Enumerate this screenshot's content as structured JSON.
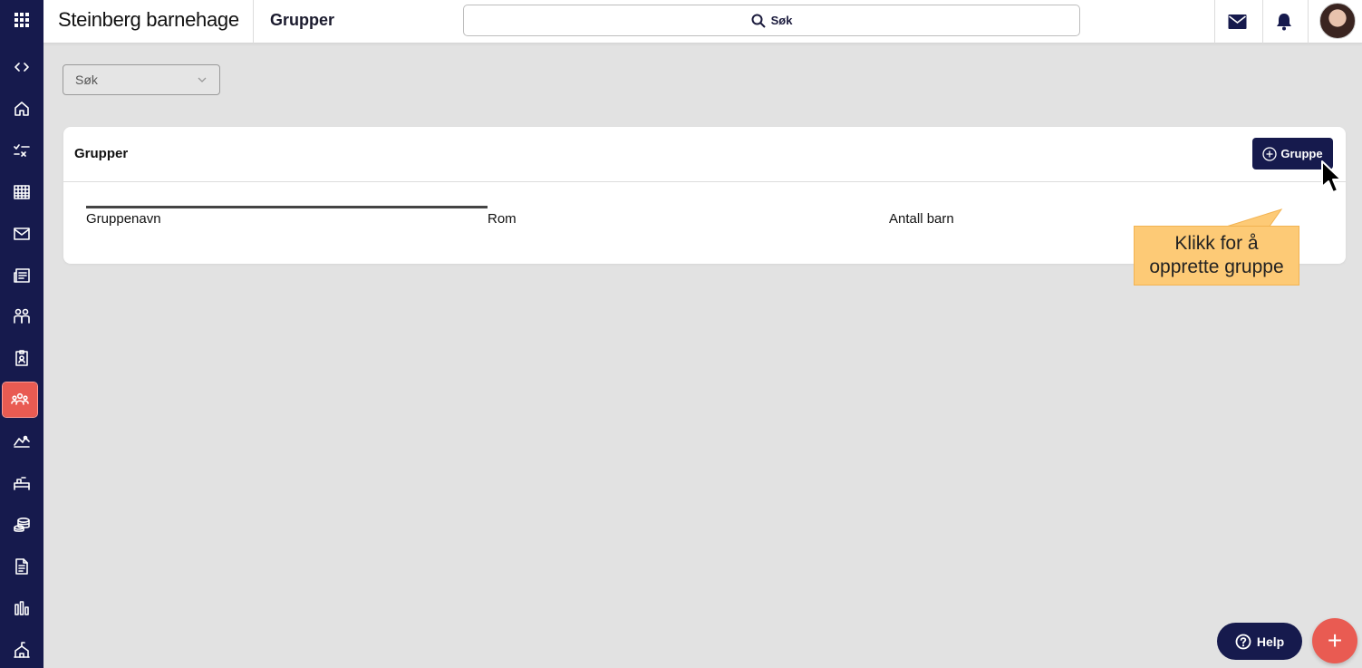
{
  "app": {
    "org_name": "Steinberg barnehage",
    "page_title": "Grupper"
  },
  "topbar": {
    "search_label": "Søk",
    "icons": [
      "mail-icon",
      "bell-icon",
      "avatar"
    ]
  },
  "sidebar": {
    "items": [
      {
        "icon": "apps-grid-icon"
      },
      {
        "icon": "expand-code-icon"
      },
      {
        "icon": "home-icon"
      },
      {
        "icon": "checklist-icon"
      },
      {
        "icon": "calendar-grid-icon"
      },
      {
        "icon": "envelope-icon"
      },
      {
        "icon": "news-icon"
      },
      {
        "icon": "people-icon"
      },
      {
        "icon": "clipboard-badge-icon"
      },
      {
        "icon": "groups-icon",
        "active": true
      },
      {
        "icon": "activity-icon"
      },
      {
        "icon": "bed-icon"
      },
      {
        "icon": "coins-icon"
      },
      {
        "icon": "document-icon"
      },
      {
        "icon": "bar-chart-icon"
      },
      {
        "icon": "building-icon"
      }
    ]
  },
  "filter": {
    "value": "Søk"
  },
  "card": {
    "title": "Grupper",
    "add_button_label": "Gruppe",
    "columns": [
      "Gruppenavn",
      "Rom",
      "Antall barn"
    ]
  },
  "tooltip": {
    "line1": "Klikk for å",
    "line2": "opprette gruppe"
  },
  "help": {
    "label": "Help"
  },
  "fab": {
    "label": "+"
  },
  "colors": {
    "navy": "#161a4d",
    "accent": "#e95b52",
    "tooltip": "#fdca76",
    "background": "#e2e2e2"
  }
}
